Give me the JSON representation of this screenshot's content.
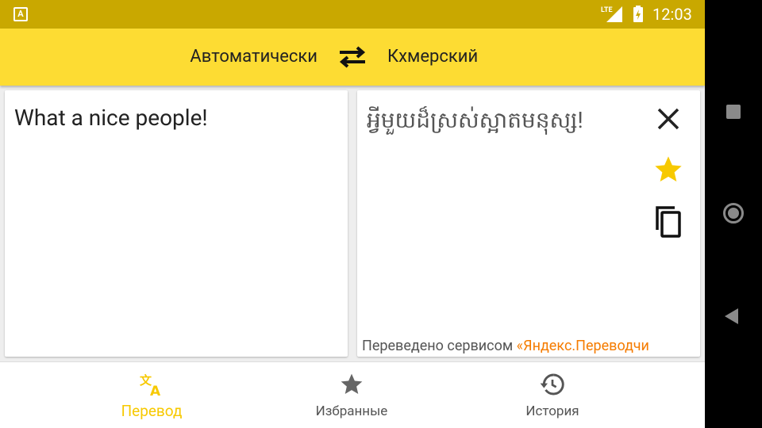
{
  "status_bar": {
    "app_icon": "A",
    "network": "LTE",
    "time": "12:03"
  },
  "header": {
    "source_language": "Автоматически",
    "target_language": "Кхмерский",
    "swap_icon": "swap-arrows-icon"
  },
  "input_panel": {
    "text": "What a nice people!"
  },
  "output_panel": {
    "text": "អ្វីមួយដ៏ស្រស់ស្អាតមនុស្ស!",
    "actions": [
      "close-icon",
      "star-icon",
      "copy-icon"
    ],
    "attribution_prefix": "Переведено сервисом ",
    "attribution_link": "«Яндекс.Переводчи"
  },
  "bottom_nav": {
    "items": [
      {
        "label": "Перевод",
        "icon": "translate-icon",
        "active": true
      },
      {
        "label": "Избранные",
        "icon": "star-icon",
        "active": false
      },
      {
        "label": "История",
        "icon": "history-icon",
        "active": false
      }
    ]
  },
  "colors": {
    "accent_yellow": "#fddc33",
    "status_bar": "#c9a800",
    "active_nav": "#f7c900",
    "star": "#f7c900",
    "link": "#f57c00"
  }
}
